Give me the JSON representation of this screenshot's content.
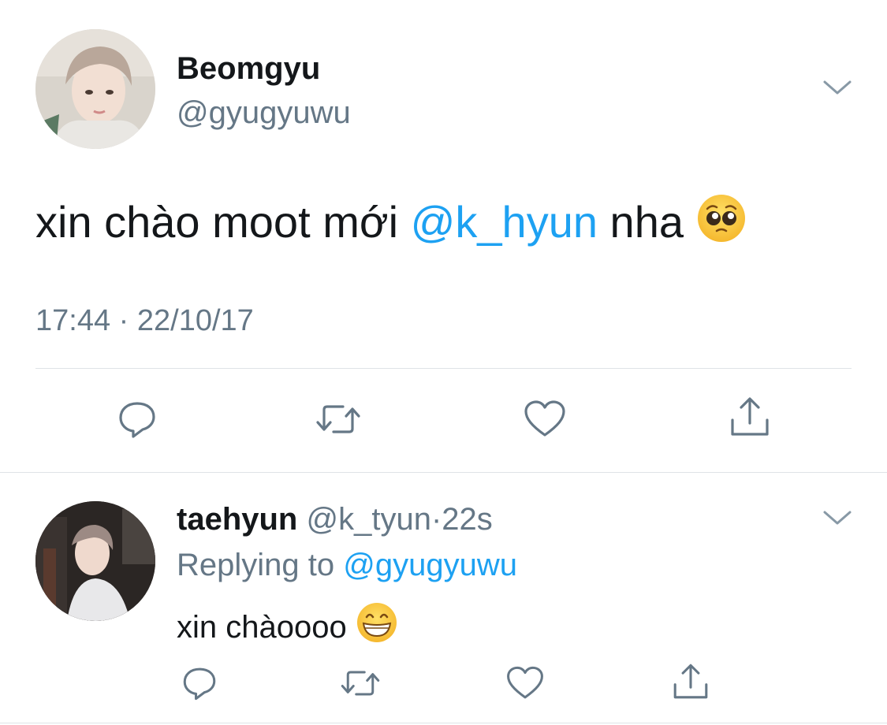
{
  "main_tweet": {
    "author_name": "Beomgyu",
    "author_handle": "@gyugyuwu",
    "text_before": "xin chào moot mới ",
    "mention": "@k_hyun",
    "text_after": " nha ",
    "emoji": "pleading-face-emoji",
    "timestamp": "17:44 · 22/10/17",
    "actions": [
      "reply-icon",
      "retweet-icon",
      "like-icon",
      "share-icon"
    ]
  },
  "reply_tweet": {
    "author_name": "taehyun",
    "author_handle": "@k_tyun",
    "separator": "·",
    "time": "22s",
    "replying_prefix": "Replying to ",
    "replying_to": "@gyugyuwu",
    "text": "xin chàoooo ",
    "emoji": "grinning-face-emoji",
    "actions": [
      "reply-icon",
      "retweet-icon",
      "like-icon",
      "share-icon"
    ]
  },
  "colors": {
    "text": "#14171a",
    "secondary": "#657786",
    "link": "#1da1f2",
    "divider": "#dfe3e7"
  }
}
